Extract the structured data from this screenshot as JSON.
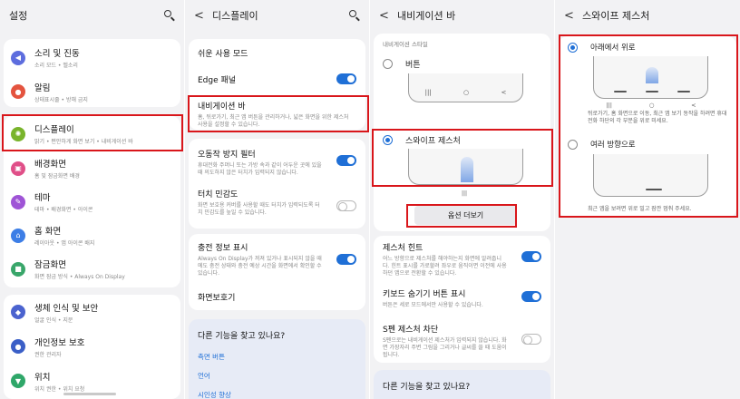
{
  "panel1": {
    "title": "설정",
    "items": [
      {
        "title": "소리 및 진동",
        "sub": "소리 모드 • 벨소리",
        "color": "#5d6dde",
        "icon": "speaker-icon"
      },
      {
        "title": "알림",
        "sub": "상태표시줄 • 방해 금지",
        "color": "#e4543f",
        "icon": "bell-icon"
      },
      {
        "title": "디스플레이",
        "sub": "밝기 • 편안하게 화면 보기 • 내비게이션 바",
        "color": "#79b42c",
        "icon": "sun-icon"
      },
      {
        "title": "배경화면",
        "sub": "홈 및 잠금화면 배경",
        "color": "#e04f88",
        "icon": "picture-icon"
      },
      {
        "title": "테마",
        "sub": "테마 • 배경화면 • 아이콘",
        "color": "#9f54d6",
        "icon": "brush-icon"
      },
      {
        "title": "홈 화면",
        "sub": "레이아웃 • 앱 아이콘 배지",
        "color": "#3d7ee6",
        "icon": "home-icon"
      },
      {
        "title": "잠금화면",
        "sub": "화면 잠금 방식 • Always On Display",
        "color": "#39a66a",
        "icon": "lock-icon"
      },
      {
        "title": "생체 인식 및 보안",
        "sub": "얼굴 인식 • 지문",
        "color": "#4b63cf",
        "icon": "shield-icon"
      },
      {
        "title": "개인정보 보호",
        "sub": "권한 관리자",
        "color": "#3b5fc7",
        "icon": "privacy-icon"
      },
      {
        "title": "위치",
        "sub": "위치 권한 • 위치 요청",
        "color": "#2fa769",
        "icon": "location-icon"
      }
    ]
  },
  "panel2": {
    "title": "디스플레이",
    "easy_mode": "쉬운 사용 모드",
    "edge_panel": "Edge 패널",
    "navbar_title": "내비게이션 바",
    "navbar_sub": "홈, 뒤로가기, 최근 앱 버튼을 관리하거나, 넓은 화면을 위한 제스처 사용을 설정할 수 있습니다.",
    "accidental_title": "오동작 방지 필터",
    "accidental_sub": "휴대전화 주머니 또는 가방 속과 같이 어두운 곳에 있을 때 의도하지 않은 터치가 입력되지 않습니다.",
    "touch_title": "터치 민감도",
    "touch_sub": "화면 보호용 커버를 사용할 때도 터치가 입력되도록 터치 민감도를 높일 수 있습니다.",
    "charging_title": "충전 정보 표시",
    "charging_sub": "Always On Display가 꺼져 있거나 표시되지 않을 때에도 충전 상태와 충전 예상 시간을 화면에서 확인할 수 있습니다.",
    "screensaver": "화면보호기",
    "more_title": "다른 기능을 찾고 있나요?",
    "links": [
      "측면 버튼",
      "언어",
      "시인성 향상"
    ]
  },
  "panel3": {
    "title": "내비게이션 바",
    "style_label": "내비게이션 스타일",
    "buttons_label": "버튼",
    "swipe_label": "스와이프 제스처",
    "options_button": "옵션 더보기",
    "hint_title": "제스처 힌트",
    "hint_sub": "어느 방향으로 제스처를 해야하는지 화면에 알려줍니다. 힌트 표시를 가로할려 좌우로 움직이면 이전에 사용하던 앱으로 전환할 수 있습니다.",
    "keyboard_title": "키보드 숨기기 버튼 표시",
    "keyboard_sub": "버튼은 세로 모드에서만 사용할 수 있습니다.",
    "spen_title": "S펜 제스처 차단",
    "spen_sub": "S펜으로는 내비게이션 제스처가 입력되지 않습니다. 화면 가장자리 주변 그림을 그리거나 글씨를 쓸 때 도움이 됩니다.",
    "more_title": "다른 기능을 찾고 있나요?",
    "nav_keys": [
      "|||",
      "○",
      "<"
    ]
  },
  "panel4": {
    "title": "스와이프 제스처",
    "option1_label": "아래에서 위로",
    "option1_desc": "뒤로가기, 홈 화면으로 이동, 최근 앱 보기 동작을 하려면 휴대전화 하단의 각 부분을 위로 미세요.",
    "option2_label": "여러 방향으로",
    "option2_desc": "최근 앱을 보려면 위로 밀고 잠깐 멈춰 주세요.",
    "nav_keys": [
      "|||",
      "○",
      "<"
    ]
  },
  "system_nav": [
    "|||",
    "○",
    "<"
  ],
  "colors": {
    "accent": "#1f6fd6",
    "highlight": "#d9161b",
    "panel_bg": "#f2f2f4"
  }
}
